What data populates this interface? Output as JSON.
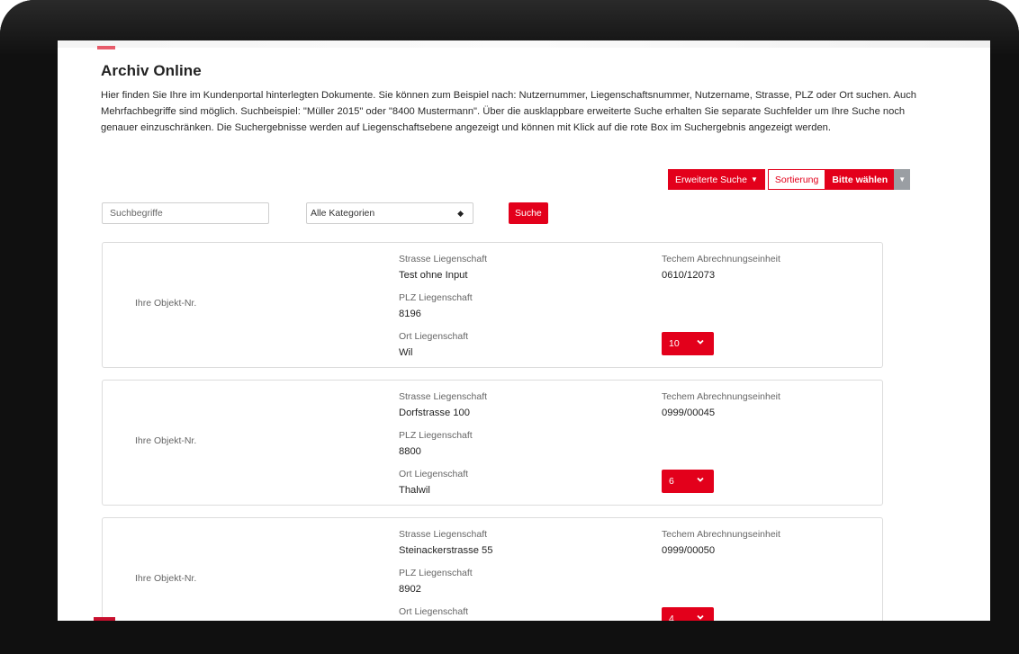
{
  "page": {
    "title": "Archiv Online",
    "intro": "Hier finden Sie Ihre im Kundenportal hinterlegten Dokumente. Sie können zum Beispiel nach: Nutzernummer, Liegenschaftsnummer, Nutzername, Strasse, PLZ oder Ort suchen. Auch Mehrfachbegriffe sind möglich. Suchbeispiel: \"Müller 2015\" oder \"8400 Mustermann\". Über die ausklappbare erweiterte Suche erhalten Sie separate Suchfelder um Ihre Suche noch genauer einzuschränken. Die Suchergebnisse werden auf Liegenschaftsebene angezeigt und können mit Klick auf die rote Box im Suchergebnis angezeigt werden."
  },
  "toolbar": {
    "advanced_search_label": "Erweiterte Suche",
    "sort_label": "Sortierung",
    "sort_value": "Bitte wählen"
  },
  "search": {
    "placeholder": "Suchbegriffe",
    "category_value": "Alle Kategorien",
    "button_label": "Suche"
  },
  "colors": {
    "accent": "#e3001b",
    "border": "#dcdcdc",
    "muted": "#9a9ea3"
  },
  "results": [
    {
      "objnr_label": "Ihre Objekt-Nr.",
      "street_label": "Strasse Liegenschaft",
      "street": "Test ohne Input",
      "plz_label": "PLZ Liegenschaft",
      "plz": "8196",
      "ort_label": "Ort Liegenschaft",
      "ort": "Wil",
      "unit_label": "Techem Abrechnungseinheit",
      "unit": "0610/12073",
      "count": "10"
    },
    {
      "objnr_label": "Ihre Objekt-Nr.",
      "street_label": "Strasse Liegenschaft",
      "street": "Dorfstrasse 100",
      "plz_label": "PLZ Liegenschaft",
      "plz": "8800",
      "ort_label": "Ort Liegenschaft",
      "ort": "Thalwil",
      "unit_label": "Techem Abrechnungseinheit",
      "unit": "0999/00045",
      "count": "6"
    },
    {
      "objnr_label": "Ihre Objekt-Nr.",
      "street_label": "Strasse Liegenschaft",
      "street": "Steinackerstrasse 55",
      "plz_label": "PLZ Liegenschaft",
      "plz": "8902",
      "ort_label": "Ort Liegenschaft",
      "ort": "",
      "unit_label": "Techem Abrechnungseinheit",
      "unit": "0999/00050",
      "count": "4"
    }
  ]
}
